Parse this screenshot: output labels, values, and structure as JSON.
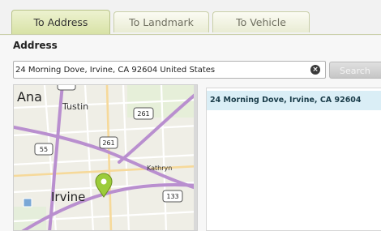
{
  "tabs": [
    {
      "label": "To Address",
      "active": true
    },
    {
      "label": "To Landmark",
      "active": false
    },
    {
      "label": "To Vehicle",
      "active": false
    }
  ],
  "address": {
    "label": "Address",
    "value": "24 Morning Dove, Irvine, CA 92604 United States",
    "search_label": "Search"
  },
  "map": {
    "labels": {
      "ana": "Ana",
      "tustin": "Tustin",
      "irvine": "Irvine",
      "kathryn": "Kathryn"
    },
    "shields": {
      "s261_top": "261",
      "s261_mid": "261",
      "s55": "55",
      "s133": "133"
    }
  },
  "results": [
    {
      "text": "24 Morning Dove, Irvine, CA 92604"
    }
  ],
  "colors": {
    "tab_active": "#d8e2a6",
    "result_highlight": "#daeef6",
    "freeway": "#b98fcf",
    "marker": "#9ccc3a"
  }
}
